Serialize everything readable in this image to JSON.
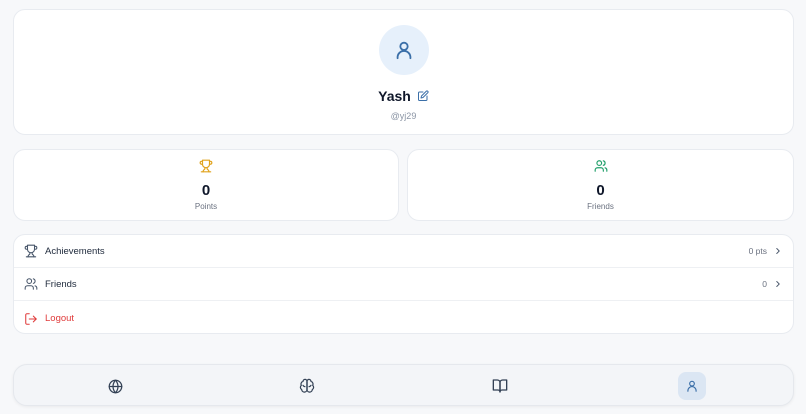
{
  "profile": {
    "name": "Yash",
    "username": "@yj29"
  },
  "stats": {
    "points": {
      "value": "0",
      "label": "Points"
    },
    "friends": {
      "value": "0",
      "label": "Friends"
    }
  },
  "menu": {
    "achievements": {
      "label": "Achievements",
      "value": "0 pts"
    },
    "friends": {
      "label": "Friends",
      "value": "0"
    },
    "logout": {
      "label": "Logout"
    }
  },
  "nav": {
    "items": [
      {
        "icon": "globe-icon"
      },
      {
        "icon": "brain-icon"
      },
      {
        "icon": "book-open-icon"
      },
      {
        "icon": "user-icon",
        "active": true
      }
    ]
  },
  "colors": {
    "accent": "#3b6fa8",
    "trophy": "#e0a21b",
    "friends": "#22a06b",
    "danger": "#e03b3b",
    "active_nav_bg": "#dbe6f3"
  }
}
